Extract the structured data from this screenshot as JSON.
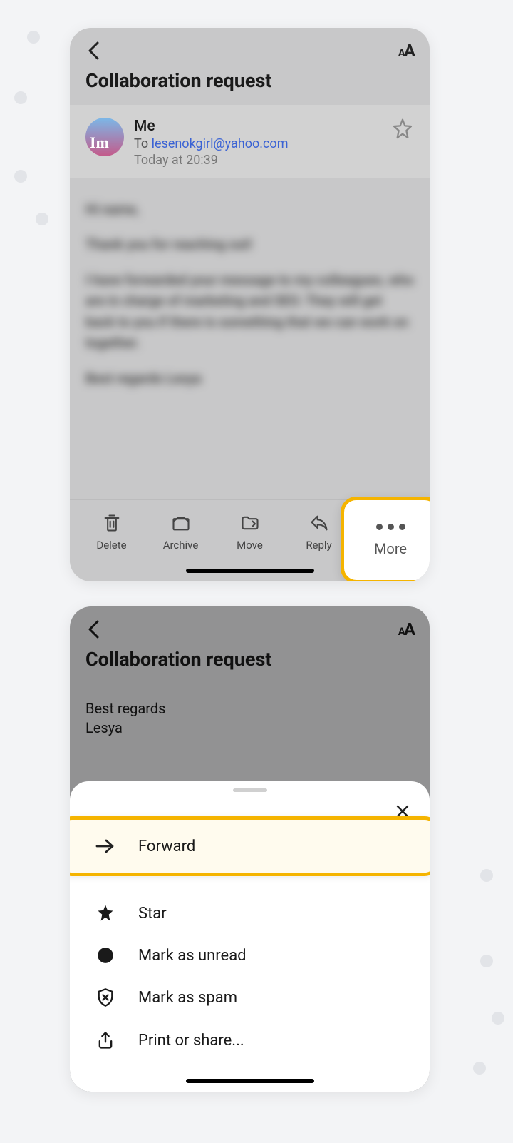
{
  "screen1": {
    "subject": "Collaboration request",
    "from": "Me",
    "to_prefix": "To ",
    "to_email": "lesenokgirl@yahoo.com",
    "date": "Today at 20:39",
    "body_blur": [
      "Hi name,",
      "Thank you for reaching out!",
      "I have forwarded your message to my colleagues, who are in charge of marketing and SEO. They will get back to you if there is something that we can work on together.",
      "Best regards Lesya"
    ],
    "toolbar": {
      "delete": "Delete",
      "archive": "Archive",
      "move": "Move",
      "reply": "Reply"
    },
    "more_label": "More"
  },
  "screen2": {
    "subject": "Collaboration request",
    "snippet_line1": "Best regards",
    "snippet_line2": "Lesya",
    "menu": {
      "forward": "Forward",
      "star": "Star",
      "mark_unread": "Mark as unread",
      "mark_spam": "Mark as spam",
      "print_share": "Print or share..."
    }
  }
}
